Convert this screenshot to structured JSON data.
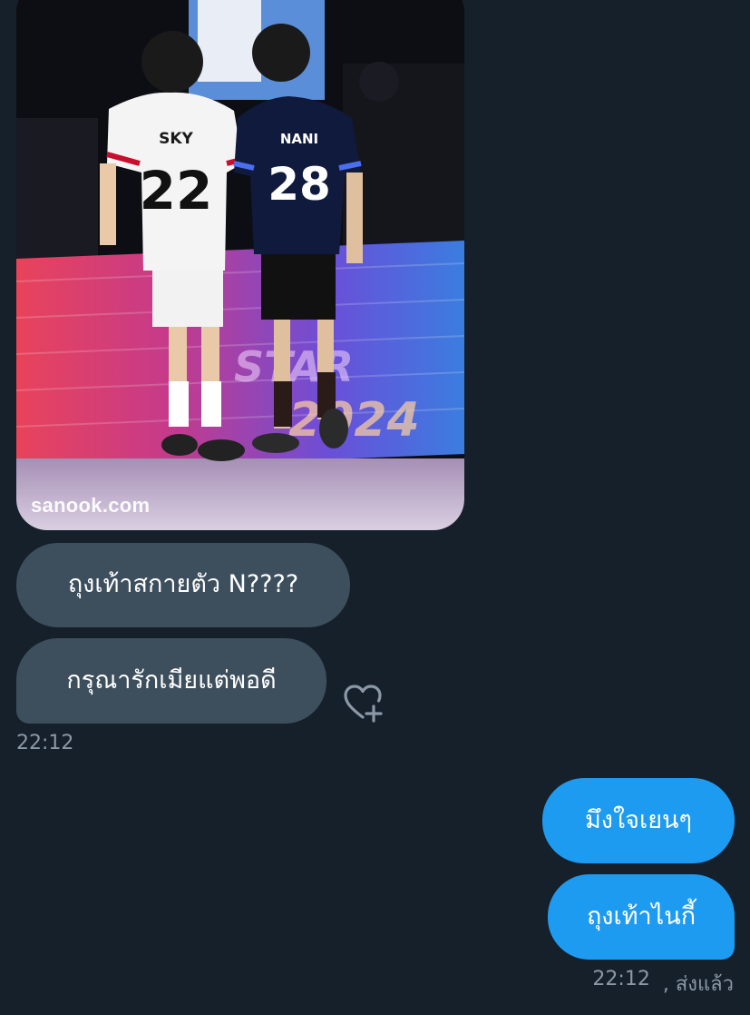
{
  "received": {
    "image": {
      "watermark": "sanook.com",
      "jerseys": [
        {
          "name": "SKY",
          "number": "22"
        },
        {
          "name": "NANI",
          "number": "28"
        }
      ]
    },
    "messages": [
      {
        "text": "ถุงเท้าสกายตัว N????"
      },
      {
        "text": "กรุณารักเมียแต่พอดี"
      }
    ],
    "react_icon": "heart-plus-icon",
    "timestamp": "22:12"
  },
  "sent": {
    "messages": [
      {
        "text": "มึงใจเยนๆ"
      },
      {
        "text": "ถุงเท้าไนกี้"
      }
    ],
    "timestamp": "22:12",
    "status": ", ส่งแล้ว"
  },
  "colors": {
    "background": "#15202b",
    "received_bubble": "#3d4f5d",
    "sent_bubble": "#1d9bf0",
    "meta_text": "#8b98a5"
  }
}
